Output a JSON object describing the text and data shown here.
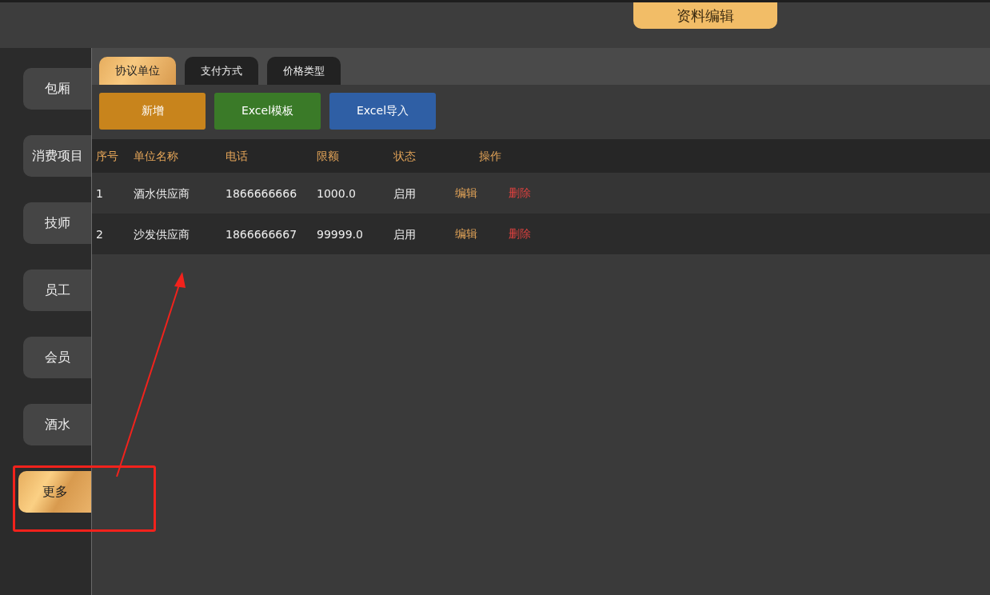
{
  "header": {
    "title": "资料编辑"
  },
  "sidebar": {
    "items": [
      {
        "label": "包厢",
        "selected": false
      },
      {
        "label": "消费项目",
        "selected": false
      },
      {
        "label": "技师",
        "selected": false
      },
      {
        "label": "员工",
        "selected": false
      },
      {
        "label": "会员",
        "selected": false
      },
      {
        "label": "酒水",
        "selected": false
      },
      {
        "label": "更多",
        "selected": true
      }
    ]
  },
  "tabs": [
    {
      "label": "协议单位",
      "selected": true
    },
    {
      "label": "支付方式",
      "selected": false
    },
    {
      "label": "价格类型",
      "selected": false
    }
  ],
  "toolbar": [
    {
      "label": "新增",
      "kind": "add"
    },
    {
      "label": "Excel模板",
      "kind": "template"
    },
    {
      "label": "Excel导入",
      "kind": "import"
    }
  ],
  "table": {
    "columns": [
      "序号",
      "单位名称",
      "电话",
      "限额",
      "状态",
      "操作"
    ],
    "rows": [
      {
        "cells": [
          "1",
          "酒水供应商",
          "1866666666",
          "1000.0",
          "启用"
        ],
        "actions": [
          {
            "label": "编辑",
            "kind": "edit"
          },
          {
            "label": "删除",
            "kind": "delete"
          }
        ]
      },
      {
        "cells": [
          "2",
          "沙发供应商",
          "1866666667",
          "99999.0",
          "启用"
        ],
        "actions": [
          {
            "label": "编辑",
            "kind": "edit"
          },
          {
            "label": "删除",
            "kind": "delete"
          }
        ]
      }
    ]
  },
  "annotation": {
    "highlight": true,
    "arrow": true
  }
}
